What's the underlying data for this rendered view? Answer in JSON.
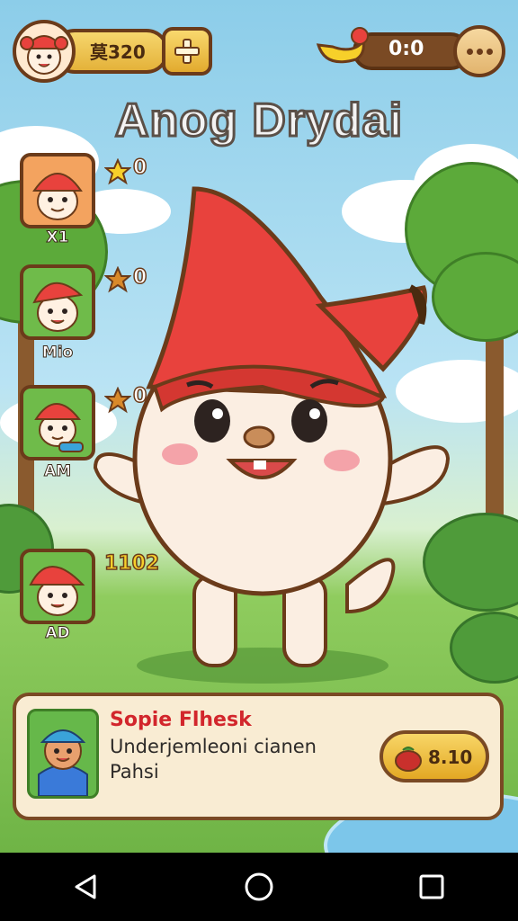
{
  "hud": {
    "currency": "莫320",
    "score": "0:0"
  },
  "title": "Anog Drydai",
  "characters": [
    {
      "name": "X1",
      "stars": "0"
    },
    {
      "name": "Mio",
      "stars": "0"
    },
    {
      "name": "AM",
      "stars": "0"
    },
    {
      "name": "AD",
      "stars": "1102"
    }
  ],
  "helper": {
    "name": "Sopie Flhesk",
    "line1": "Underjemleoni cianen",
    "line2": "Pahsi",
    "price": "8.10"
  },
  "icons": [
    "gnome-avatar-icon",
    "plus-icon",
    "banana-icon",
    "more-icon",
    "star-icon",
    "fruit-bag-icon",
    "back-icon",
    "home-icon",
    "recents-icon"
  ],
  "colors": {
    "hat_red": "#e8423d",
    "gold": "#e4b23a",
    "outline_brown": "#6b3b1a",
    "helper_name_red": "#d2262c"
  }
}
